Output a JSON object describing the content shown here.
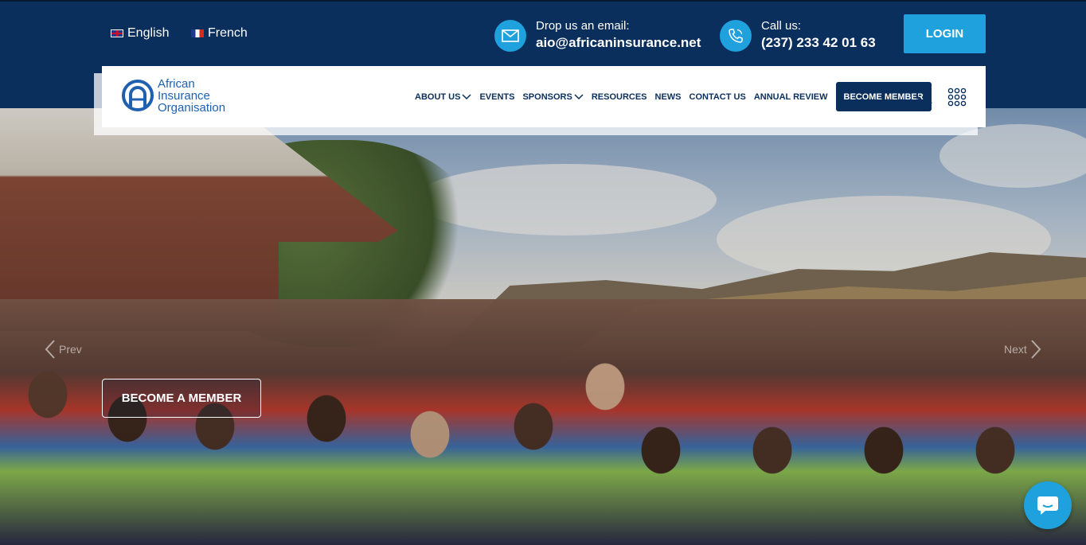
{
  "languages": [
    {
      "label": "English",
      "flag": "uk-flag-icon"
    },
    {
      "label": "French",
      "flag": "france-flag-icon"
    }
  ],
  "contact": {
    "email_label": "Drop us an email:",
    "email_value": "aio@africaninsurance.net",
    "phone_label": "Call us:",
    "phone_value": "(237) 233 42 01 63"
  },
  "login_label": "LOGIN",
  "logo": {
    "line1": "African",
    "line2": "Insurance",
    "line3": "Organisation"
  },
  "nav": {
    "items": [
      {
        "label": "ABOUT US",
        "dropdown": true
      },
      {
        "label": "EVENTS",
        "dropdown": false
      },
      {
        "label": "SPONSORS",
        "dropdown": true
      },
      {
        "label": "RESOURCES",
        "dropdown": false
      },
      {
        "label": "NEWS",
        "dropdown": false
      },
      {
        "label": "CONTACT US",
        "dropdown": false
      },
      {
        "label": "ANNUAL REVIEW",
        "dropdown": false
      }
    ],
    "cta_label": "BECOME MEMBER"
  },
  "hero": {
    "prev_label": "Prev",
    "next_label": "Next",
    "cta_label": "BECOME A MEMBER"
  },
  "colors": {
    "navy": "#0b2f5c",
    "accent_blue": "#1ea1dc",
    "white": "#ffffff"
  }
}
